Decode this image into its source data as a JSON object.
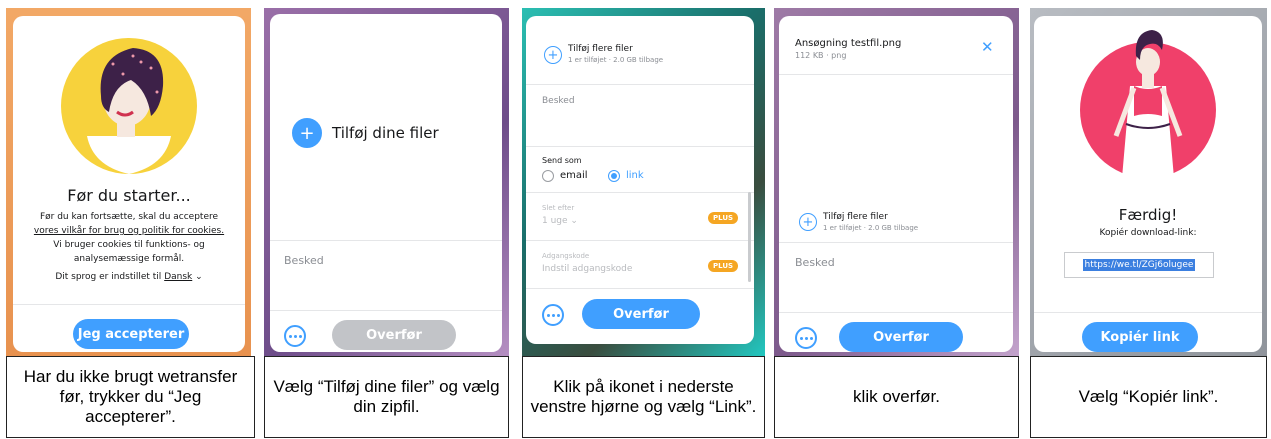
{
  "panel1": {
    "title": "Før du starter...",
    "body_lines": [
      "Før du kan fortsætte, skal du acceptere",
      "vores vilkår for brug og politik for cookies.",
      "Vi bruger cookies til funktions- og",
      "analysemæssige formål."
    ],
    "language_prefix": "Dit sprog er indstillet til",
    "language_value": "Dansk",
    "accept_label": "Jeg accepterer"
  },
  "panel2": {
    "add_files_label": "Tilføj dine filer",
    "message_placeholder": "Besked",
    "transfer_label": "Overfør"
  },
  "panel3": {
    "add_more_label": "Tilføj flere filer",
    "add_more_sub": "1 er tilføjet · 2.0 GB tilbage",
    "message_placeholder": "Besked",
    "send_as_label": "Send som",
    "option_email": "email",
    "option_link": "link",
    "expires_label": "Slet efter",
    "expires_value": "1 uge",
    "password_label": "Adgangskode",
    "password_placeholder": "Indstil adgangskode",
    "plus_badge": "PLUS",
    "transfer_label": "Overfør"
  },
  "panel4": {
    "file_name": "Ansøgning testfil.png",
    "file_meta": "112 KB · png",
    "add_more_label": "Tilføj flere filer",
    "add_more_sub": "1 er tilføjet · 2.0 GB tilbage",
    "message_placeholder": "Besked",
    "transfer_label": "Overfør"
  },
  "panel5": {
    "title": "Færdig!",
    "subtitle": "Kopiér download-link:",
    "link": "https://we.tl/ZGj6olugee",
    "copy_label": "Kopiér link"
  },
  "captions": [
    "Har du ikke brugt wetransfer før, trykker du “Jeg accepterer”.",
    "Vælg “Tilføj dine filer” og vælg din zipfil.",
    "Klik på ikonet i nederste venstre hjørne og vælg “Link”.",
    "klik overfør.",
    "Vælg “Kopiér link”."
  ],
  "colors": {
    "accent": "#409fff",
    "panel1_bg": "#f0a35e",
    "illustration_yellow": "#f7d23c",
    "illustration_pink": "#f0406a",
    "plus_badge": "#f5a623"
  }
}
